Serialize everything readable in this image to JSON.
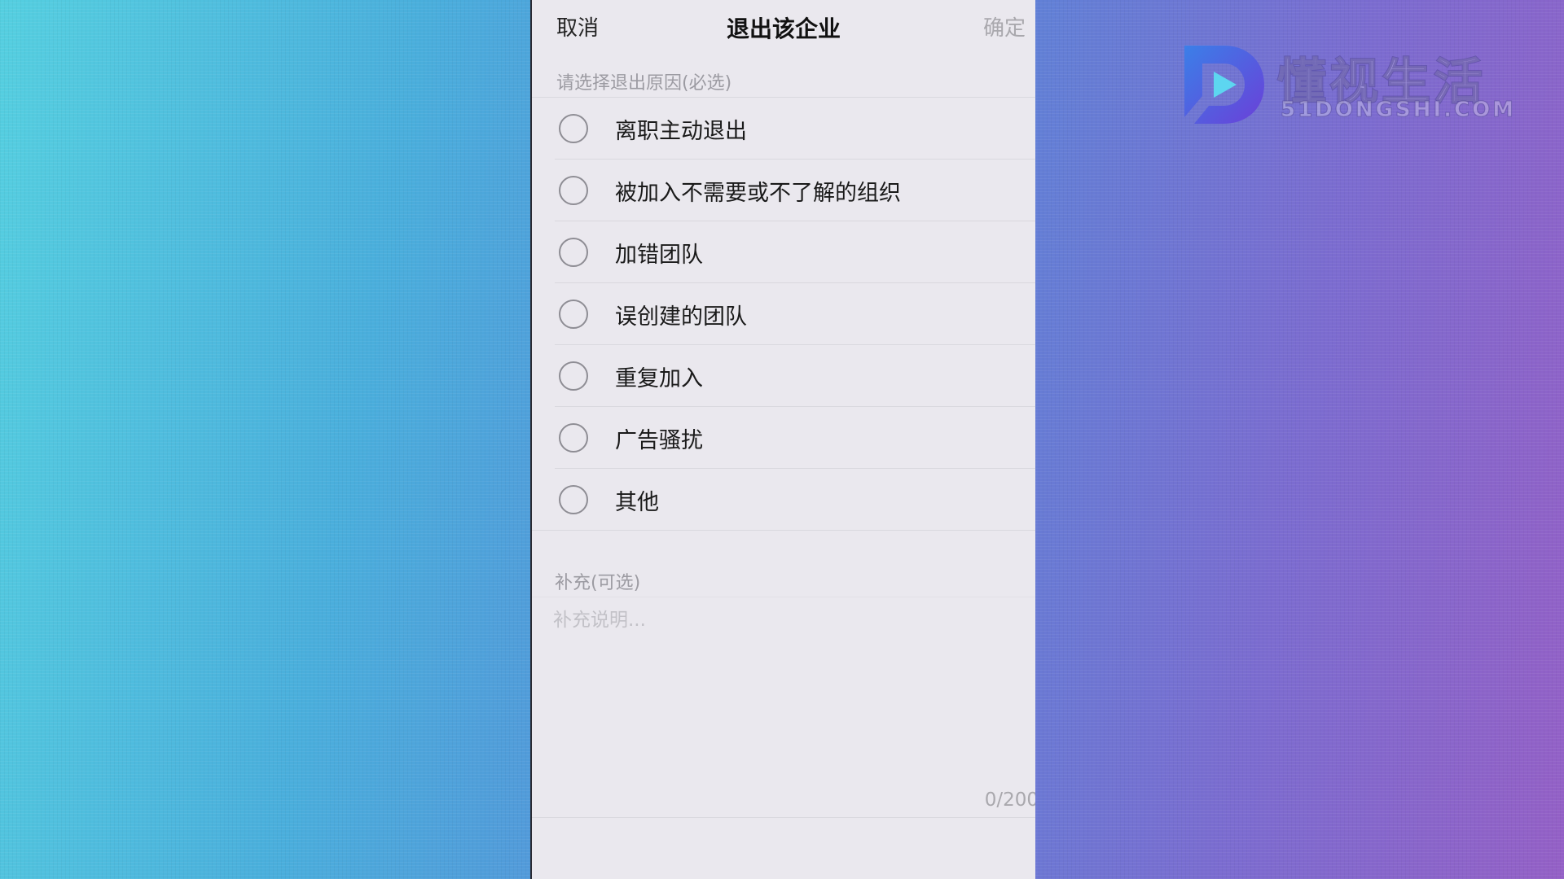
{
  "nav": {
    "cancel_label": "取消",
    "title": "退出该企业",
    "confirm_label": "确定"
  },
  "reason_section": {
    "header": "请选择退出原因(必选)",
    "options": [
      {
        "label": "离职主动退出",
        "selected": false
      },
      {
        "label": "被加入不需要或不了解的组织",
        "selected": false
      },
      {
        "label": "加错团队",
        "selected": false
      },
      {
        "label": "误创建的团队",
        "selected": false
      },
      {
        "label": "重复加入",
        "selected": false
      },
      {
        "label": "广告骚扰",
        "selected": false
      },
      {
        "label": "其他",
        "selected": false
      }
    ]
  },
  "supplement": {
    "header": "补充(可选)",
    "placeholder": "补充说明...",
    "value": "",
    "counter": "0/200"
  },
  "watermark": {
    "title": "懂视生活",
    "subtitle": "51DONGSHI.COM"
  },
  "colors": {
    "panel_bg": "#eae8ee",
    "confirm_disabled": "#a9a8ad",
    "section_header": "#9c9ba2",
    "radio_border": "#8e8d94"
  }
}
